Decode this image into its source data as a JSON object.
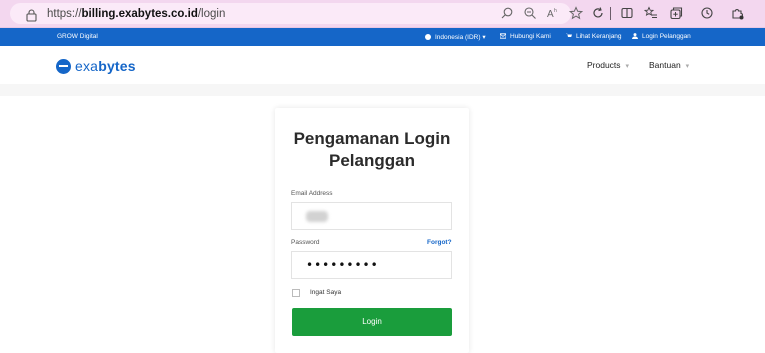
{
  "browser": {
    "url_prefix": "https://",
    "url_host": "billing.exabytes.co.id",
    "url_path": "/login",
    "icons": [
      "search-icon",
      "zoom-icon",
      "read-aloud-icon",
      "favorite-icon",
      "refresh-icon",
      "split-screen-icon",
      "favorites-list-icon",
      "collections-icon",
      "history-icon",
      "extensions-icon"
    ]
  },
  "topbar": {
    "brand": "GROW Digital",
    "items": [
      {
        "label": "Indonesia (IDR) ▾",
        "icon": "globe-icon"
      },
      {
        "label": "Hubungi Kami",
        "icon": "mail-icon"
      },
      {
        "label": "Lihat Keranjang",
        "icon": "cart-icon"
      },
      {
        "label": "Login Pelanggan",
        "icon": "user-icon"
      }
    ]
  },
  "header": {
    "logo_prefix": "exa",
    "logo_bold": "bytes",
    "nav": [
      "Products",
      "Bantuan"
    ],
    "caret": "▾"
  },
  "login": {
    "title": "Pengamanan Login Pelanggan",
    "email_label": "Email Address",
    "password_label": "Password",
    "forgot_label": "Forgot?",
    "password_value": "•••••••••",
    "remember_label": "Ingat Saya",
    "button_label": "Login"
  },
  "colors": {
    "brand_blue": "#1566c8",
    "button_green": "#1a9d3c",
    "browser_bar": "#f3d7ef"
  }
}
